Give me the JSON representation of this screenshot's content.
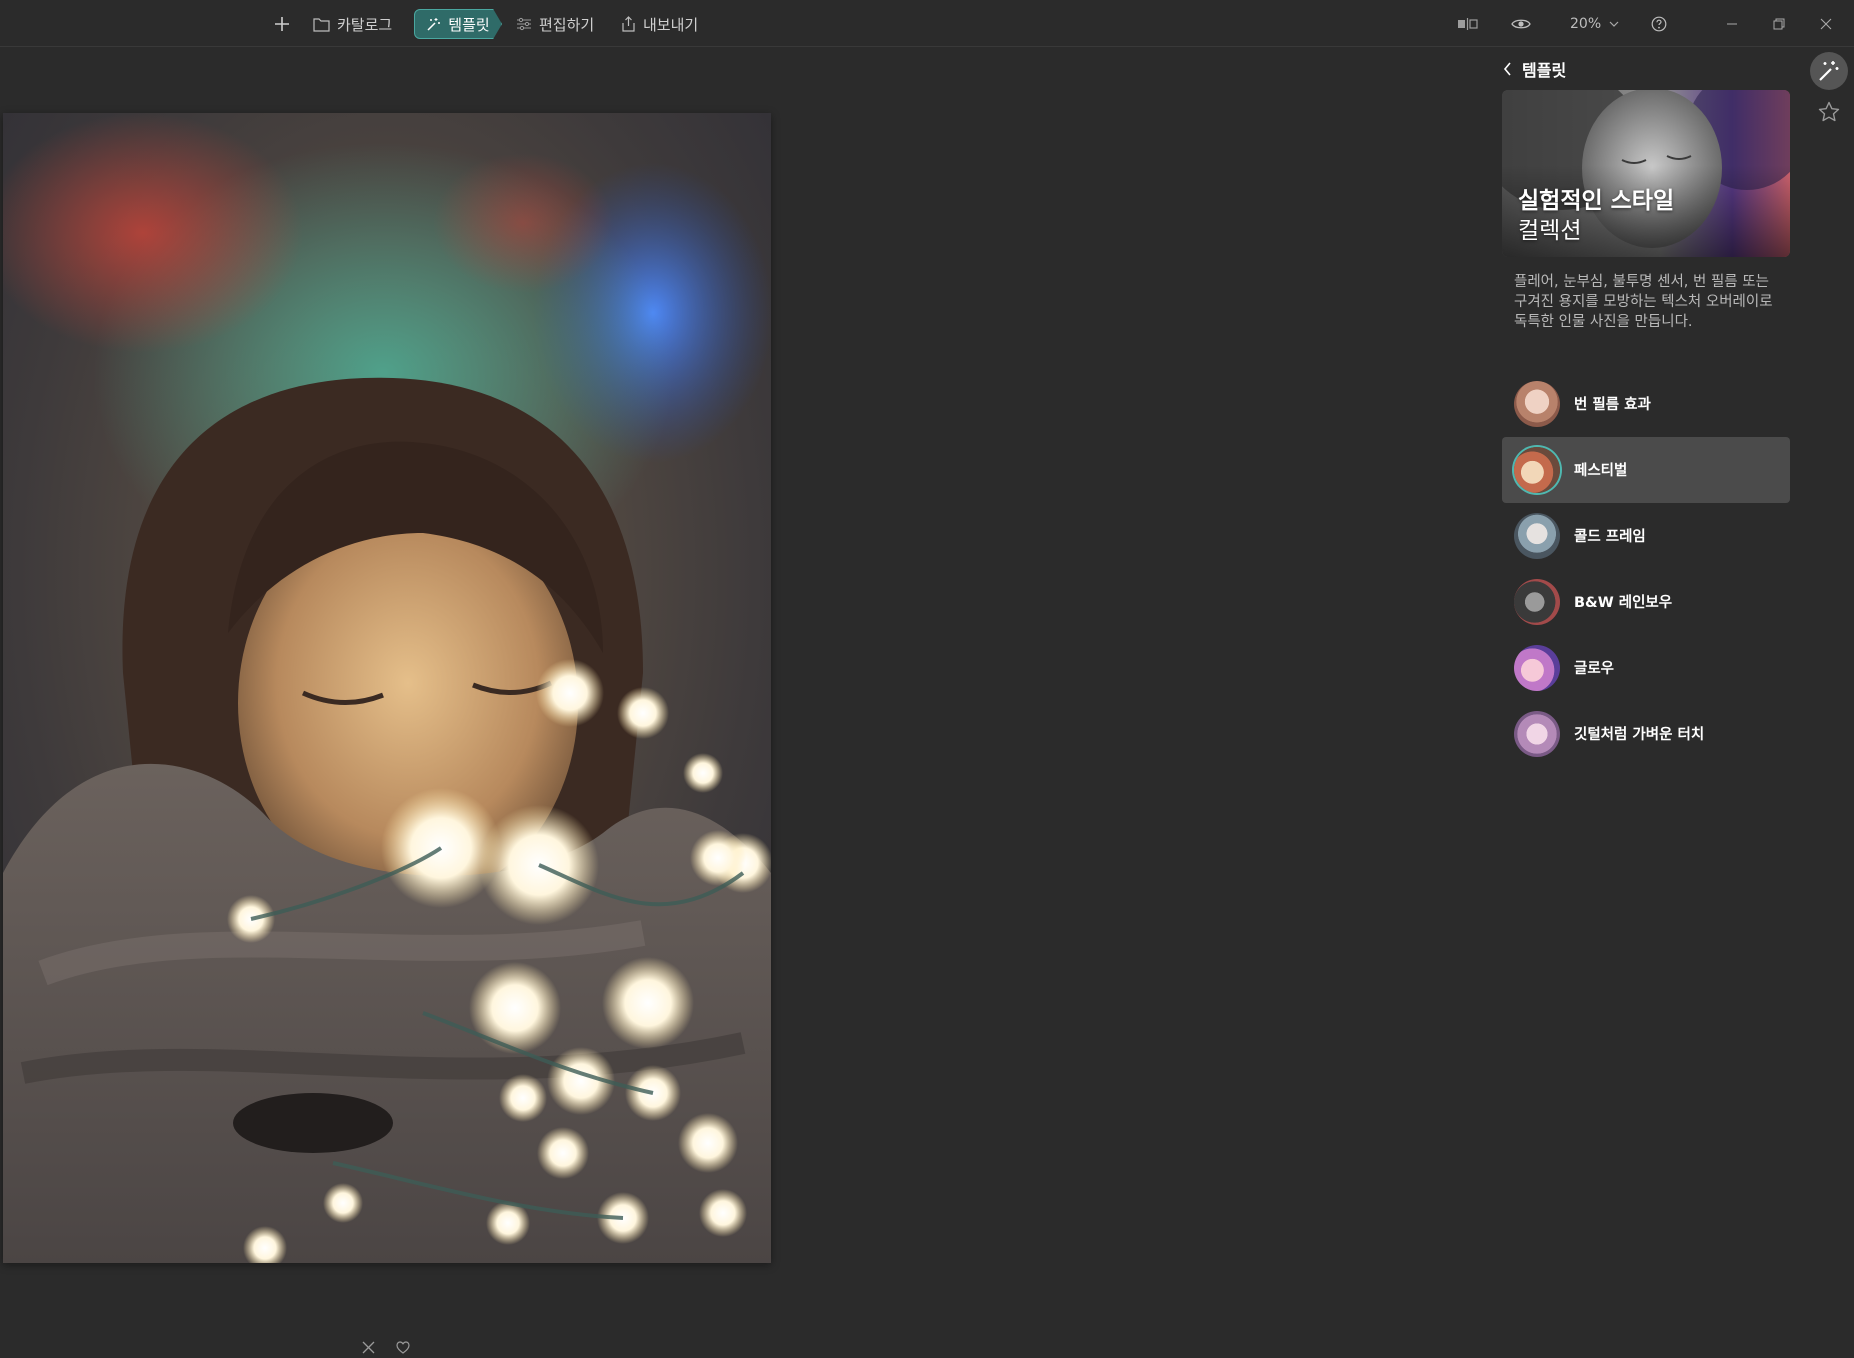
{
  "toolbar": {
    "add_icon": "plus-icon",
    "catalog_label": "카탈로그",
    "templates_label": "템플릿",
    "edit_label": "편집하기",
    "export_label": "내보내기",
    "zoom_value": "20%",
    "accent_color": "#2f6b68"
  },
  "panel": {
    "back_label": "템플릿",
    "hero": {
      "title_line1": "실험적인 스타일",
      "title_line2": "컬렉션"
    },
    "description": "플레어, 눈부심, 불투명 센서, 번 필름 또는 구겨진 용지를 모방하는 텍스처 오버레이로 독특한 인물 사진을 만듭니다.",
    "templates": [
      {
        "label": "번 필름 효과",
        "selected": false
      },
      {
        "label": "페스티벌",
        "selected": true
      },
      {
        "label": "콜드 프레임",
        "selected": false
      },
      {
        "label": "B&W 레인보우",
        "selected": false
      },
      {
        "label": "글로우",
        "selected": false
      },
      {
        "label": "깃털처럼 가벼운 터치",
        "selected": false
      }
    ]
  }
}
